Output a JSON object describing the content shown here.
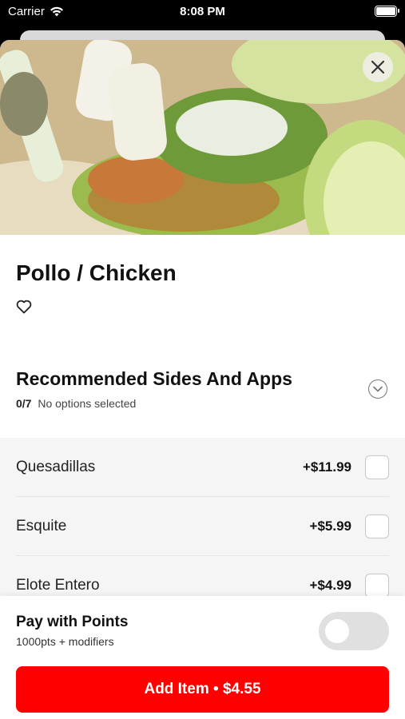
{
  "status_bar": {
    "carrier": "Carrier",
    "time": "8:08 PM",
    "wifi_icon": "wifi-icon",
    "battery_icon": "battery-icon"
  },
  "header": {
    "close_icon": "close-icon"
  },
  "item": {
    "title": "Pollo / Chicken",
    "favorite_icon": "heart-outline-icon"
  },
  "section": {
    "title": "Recommended Sides And Apps",
    "count": "0/7",
    "status": "No options selected",
    "expand_icon": "chevron-down-circle-icon"
  },
  "options": [
    {
      "name": "Quesadillas",
      "price": "+$11.99",
      "checked": false
    },
    {
      "name": "Esquite",
      "price": "+$5.99",
      "checked": false
    },
    {
      "name": "Elote Entero",
      "price": "+$4.99",
      "checked": false
    }
  ],
  "footer": {
    "points_title": "Pay with Points",
    "points_subtitle": "1000pts + modifiers",
    "points_toggle_on": false,
    "add_button_label": "Add Item • $4.55"
  },
  "colors": {
    "accent": "#ff0000",
    "options_bg": "#f5f5f5"
  }
}
